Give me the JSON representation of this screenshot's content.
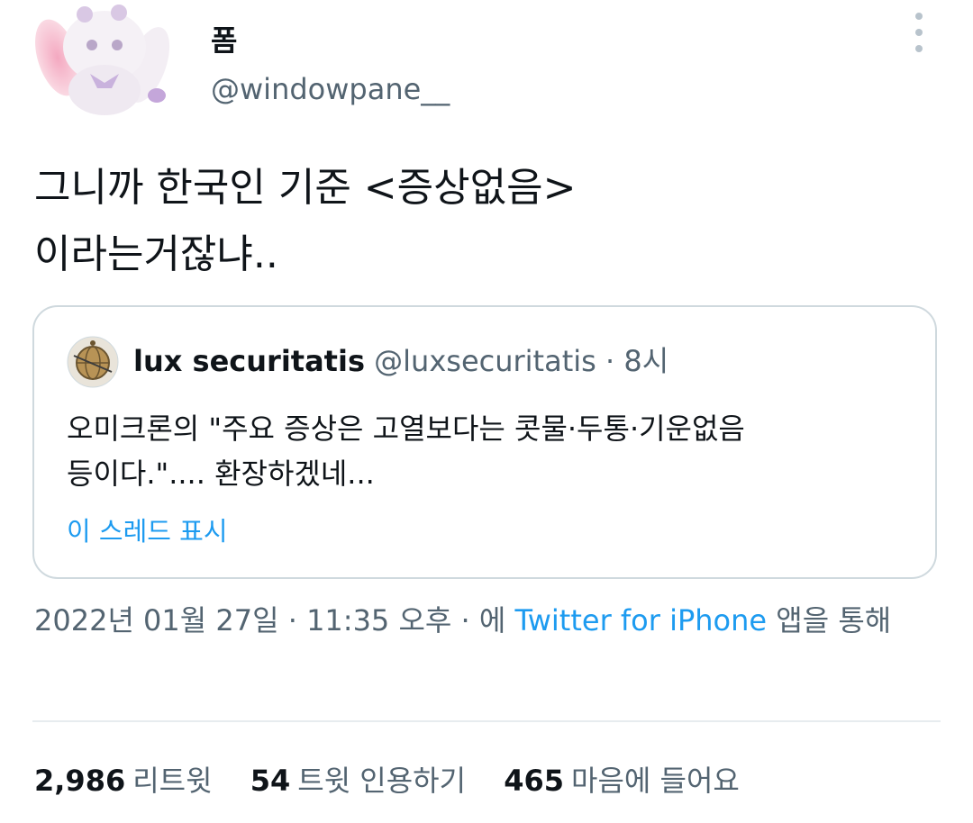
{
  "author": {
    "display_name": "폼",
    "handle": "@windowpane__",
    "avatar_icon": "plush-bunny-avatar"
  },
  "tweet": {
    "lines": [
      "그니까 한국인 기준 <증상없음>",
      "이라는거잖냐.."
    ]
  },
  "quote": {
    "avatar_icon": "globe-avatar",
    "name": "lux securitatis",
    "handle": "@luxsecuritatis",
    "separator": "·",
    "time": "8시",
    "lines": [
      "오미크론의 \"주요 증상은 고열보다는 콧물·두통·기운없음",
      "등이다.\".... 환장하겠네..."
    ],
    "show_thread": "이 스레드 표시"
  },
  "meta": {
    "date": "2022년 01월 27일",
    "sep1": "·",
    "time": "11:35 오후",
    "sep2": "·",
    "via_prefix": "에",
    "source": "Twitter for iPhone",
    "via_suffix": "앱을 통해"
  },
  "stats": [
    {
      "count": "2,986",
      "label": "리트윗"
    },
    {
      "count": "54",
      "label": "트윗 인용하기"
    },
    {
      "count": "465",
      "label": "마음에 들어요"
    }
  ],
  "colors": {
    "link": "#1d9bf0",
    "secondary_text": "#536471",
    "border": "#cfd9de"
  }
}
